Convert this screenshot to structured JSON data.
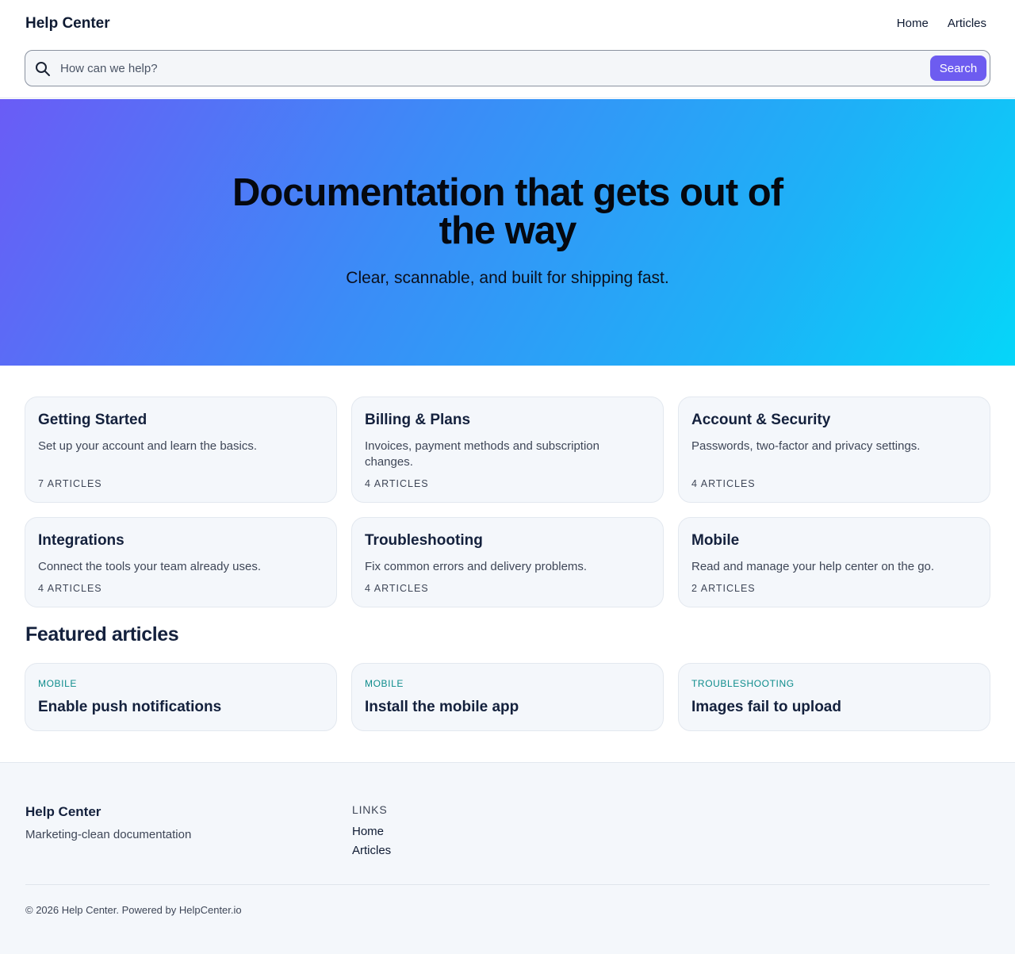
{
  "header": {
    "brand": "Help Center",
    "nav": [
      {
        "label": "Home"
      },
      {
        "label": "Articles"
      }
    ],
    "search": {
      "placeholder": "How can we help?",
      "button_label": "Search"
    }
  },
  "hero": {
    "title": "Documentation that gets out of the way",
    "subtitle": "Clear, scannable, and built for shipping fast."
  },
  "categories": [
    {
      "title": "Getting Started",
      "desc": "Set up your account and learn the basics.",
      "count": "7 ARTICLES"
    },
    {
      "title": "Billing & Plans",
      "desc": "Invoices, payment methods and subscription changes.",
      "count": "4 ARTICLES"
    },
    {
      "title": "Account & Security",
      "desc": "Passwords, two-factor and privacy settings.",
      "count": "4 ARTICLES"
    },
    {
      "title": "Integrations",
      "desc": "Connect the tools your team already uses.",
      "count": "4 ARTICLES"
    },
    {
      "title": "Troubleshooting",
      "desc": "Fix common errors and delivery problems.",
      "count": "4 ARTICLES"
    },
    {
      "title": "Mobile",
      "desc": "Read and manage your help center on the go.",
      "count": "2 ARTICLES"
    }
  ],
  "featured": {
    "title": "Featured articles",
    "items": [
      {
        "tag": "MOBILE",
        "title": "Enable push notifications"
      },
      {
        "tag": "MOBILE",
        "title": "Install the mobile app"
      },
      {
        "tag": "TROUBLESHOOTING",
        "title": "Images fail to upload"
      }
    ]
  },
  "footer": {
    "brand": "Help Center",
    "tagline": "Marketing-clean documentation",
    "links_heading": "LINKS",
    "links": [
      {
        "label": "Home"
      },
      {
        "label": "Articles"
      }
    ],
    "copyright": "© 2026 Help Center. Powered by HelpCenter.io"
  },
  "colors": {
    "accent": "#6d5cf0",
    "tag": "#0e8c8c",
    "hero_gradient": [
      "#6a5cf6",
      "#05d6f9"
    ]
  },
  "icons": {
    "search": "search-icon"
  }
}
